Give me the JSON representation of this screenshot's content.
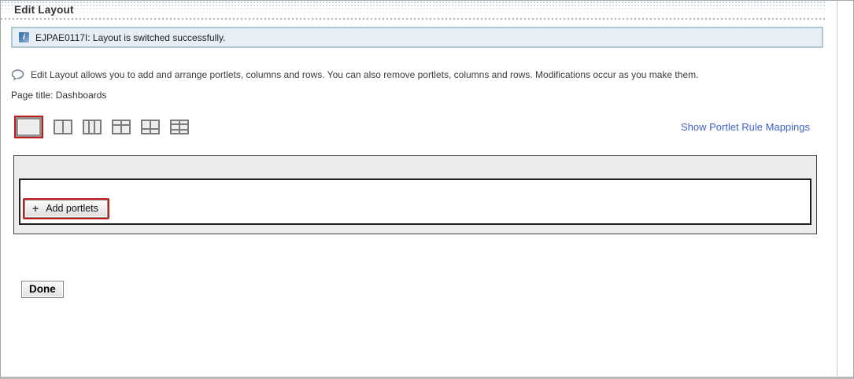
{
  "header": {
    "title": "Edit Layout"
  },
  "info_message": {
    "icon": "info-icon",
    "text": "EJPAE0117I: Layout is switched successfully."
  },
  "help": {
    "icon": "speech-bubble-icon",
    "text": "Edit Layout allows you to add and arrange portlets, columns and rows. You can also remove portlets, columns and rows. Modifications occur as you make them."
  },
  "page_info": {
    "label": "Page title:",
    "value": "Dashboards"
  },
  "layout_selector": {
    "options": [
      {
        "name": "one-column",
        "selected": true,
        "annotated": true
      },
      {
        "name": "two-columns",
        "selected": false
      },
      {
        "name": "three-columns",
        "selected": false
      },
      {
        "name": "header-two-columns",
        "selected": false
      },
      {
        "name": "two-columns-footer",
        "selected": false
      },
      {
        "name": "header-two-columns-footer",
        "selected": false
      }
    ]
  },
  "links": {
    "show_portlet_rule_mappings": "Show Portlet Rule Mappings"
  },
  "layout_container": {
    "plus_icon": "+",
    "add_portlets_label": "Add portlets"
  },
  "buttons": {
    "done": "Done"
  },
  "colors": {
    "annotation_highlight": "#c21d1d",
    "link": "#3e63c6",
    "info_bar_bg": "#e7eff6",
    "info_bar_border": "#afc8cd",
    "icon_gray": "#7b7b7b"
  }
}
